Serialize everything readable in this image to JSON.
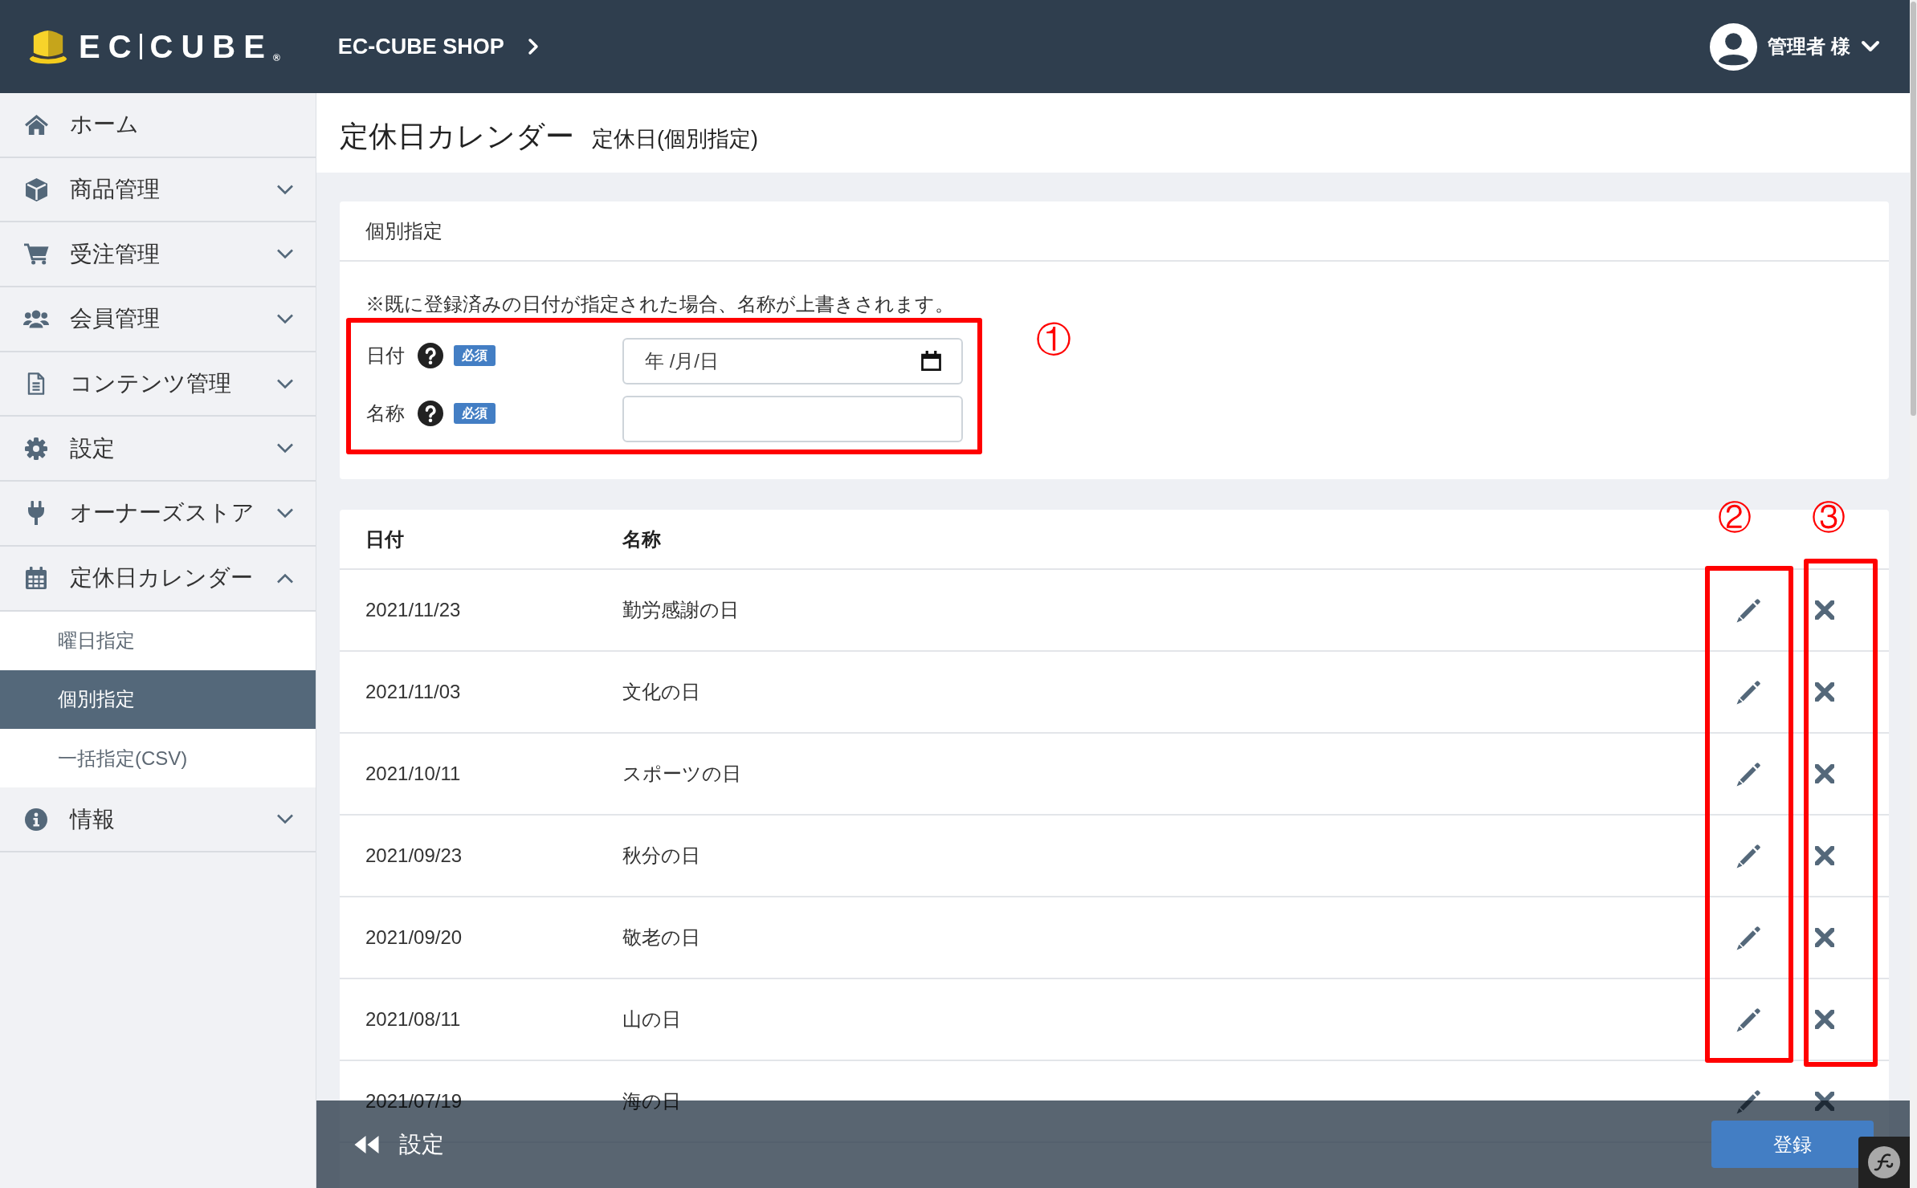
{
  "header": {
    "logo": {
      "left": "EC",
      "right": "CUBE",
      "mark": "®"
    },
    "shop_name": "EC-CUBE SHOP",
    "user_name": "管理者 様"
  },
  "sidebar": {
    "items": [
      {
        "kind": "link",
        "label": "ホーム"
      },
      {
        "kind": "group",
        "label": "商品管理",
        "expanded": false
      },
      {
        "kind": "group",
        "label": "受注管理",
        "expanded": false
      },
      {
        "kind": "group",
        "label": "会員管理",
        "expanded": false
      },
      {
        "kind": "group",
        "label": "コンテンツ管理",
        "expanded": false
      },
      {
        "kind": "group",
        "label": "設定",
        "expanded": false
      },
      {
        "kind": "group",
        "label": "オーナーズストア",
        "expanded": false
      },
      {
        "kind": "group",
        "label": "定休日カレンダー",
        "expanded": true,
        "children": [
          {
            "label": "曜日指定",
            "selected": false
          },
          {
            "label": "個別指定",
            "selected": true
          },
          {
            "label": "一括指定(CSV)",
            "selected": false
          }
        ]
      },
      {
        "kind": "group",
        "label": "情報",
        "expanded": false
      }
    ]
  },
  "page": {
    "title": "定休日カレンダー",
    "subtitle": "定休日(個別指定)"
  },
  "form_card": {
    "title": "個別指定",
    "note": "※既に登録済みの日付が指定された場合、名称が上書きされます。",
    "fields": [
      {
        "kind": "date",
        "label": "日付",
        "badge": "必須",
        "placeholder": "年 /月/日"
      },
      {
        "kind": "text",
        "label": "名称",
        "badge": "必須"
      }
    ]
  },
  "table": {
    "columns": [
      "日付",
      "名称"
    ],
    "rows": [
      {
        "date": "2021/11/23",
        "name": "勤労感謝の日"
      },
      {
        "date": "2021/11/03",
        "name": "文化の日"
      },
      {
        "date": "2021/10/11",
        "name": "スポーツの日"
      },
      {
        "date": "2021/09/23",
        "name": "秋分の日"
      },
      {
        "date": "2021/09/20",
        "name": "敬老の日"
      },
      {
        "date": "2021/08/11",
        "name": "山の日"
      },
      {
        "date": "2021/07/19",
        "name": "海の日"
      }
    ]
  },
  "annotations": [
    {
      "label": "①"
    },
    {
      "label": "②"
    },
    {
      "label": "③"
    }
  ],
  "footer_bar": {
    "back_label": "設定",
    "submit_label": "登録"
  }
}
